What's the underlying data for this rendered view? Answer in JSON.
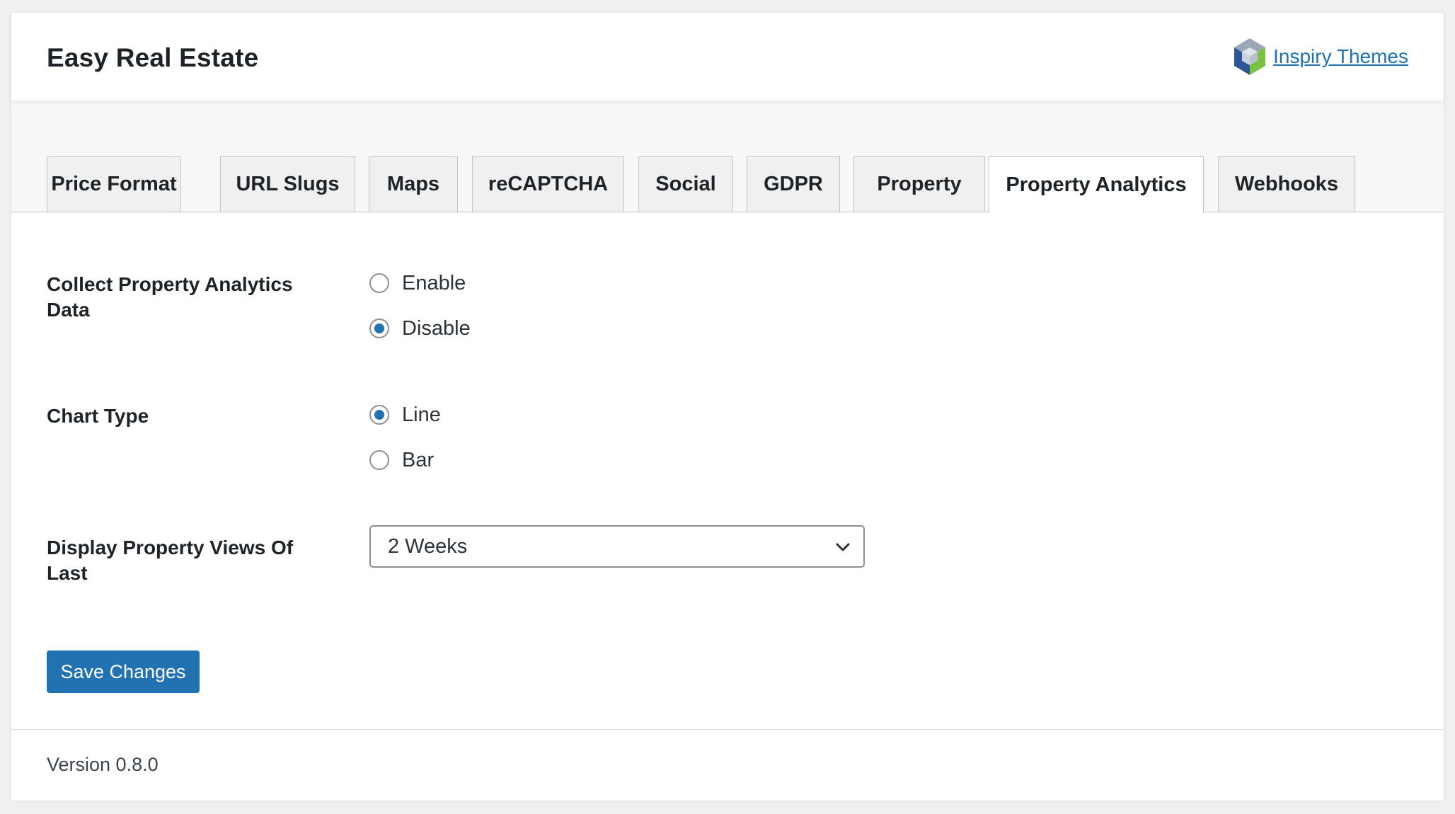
{
  "header": {
    "title": "Easy Real Estate",
    "brand_link": "Inspiry Themes"
  },
  "tabs": [
    {
      "label": "Price Format",
      "active": false
    },
    {
      "label": "URL Slugs",
      "active": false
    },
    {
      "label": "Maps",
      "active": false
    },
    {
      "label": "reCAPTCHA",
      "active": false
    },
    {
      "label": "Social",
      "active": false
    },
    {
      "label": "GDPR",
      "active": false
    },
    {
      "label": "Property",
      "active": false
    },
    {
      "label": "Property Analytics",
      "active": true
    },
    {
      "label": "Webhooks",
      "active": false
    }
  ],
  "form": {
    "collect": {
      "label": "Collect Property Analytics Data",
      "options": [
        {
          "label": "Enable",
          "checked": false
        },
        {
          "label": "Disable",
          "checked": true
        }
      ]
    },
    "chart_type": {
      "label": "Chart Type",
      "options": [
        {
          "label": "Line",
          "checked": true
        },
        {
          "label": "Bar",
          "checked": false
        }
      ]
    },
    "views_period": {
      "label": "Display Property Views Of Last",
      "selected": "2 Weeks"
    },
    "save_label": "Save Changes"
  },
  "footer": {
    "version": "Version 0.8.0"
  },
  "colors": {
    "accent": "#2271b1",
    "background": "#f0f0f1"
  }
}
